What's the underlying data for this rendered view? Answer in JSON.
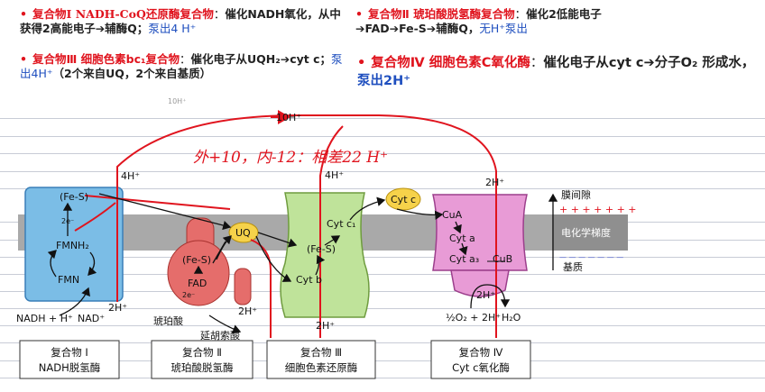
{
  "notes": [
    {
      "bullet": "•",
      "title": "复合物Ⅰ NADH-CoQ还原酶复合物",
      "colon": "：",
      "desc": "催化NADH氧化，从中获得2高能电子➔辅酶Q；",
      "pump": "泵出4 H⁺"
    },
    {
      "bullet": "•",
      "title": "复合物Ⅱ 琥珀酸脱氢酶复合物",
      "colon": "：",
      "desc": "催化2低能电子➔FAD➔Fe-S➔辅酶Q，",
      "pump": "无H⁺泵出"
    },
    {
      "bullet": "•",
      "title": "复合物Ⅲ 细胞色素bc₁复合物",
      "colon": "：",
      "desc": "催化电子从UQH₂➔cyt c；",
      "pump": "泵出4H⁺",
      "extra": "（2个来自UQ，2个来自基质）"
    },
    {
      "bullet": "•",
      "title": "复合物Ⅳ 细胞色素C氧化酶",
      "colon": "：",
      "desc": "催化电子从cyt c➔分子O₂ 形成水，",
      "pump": "泵出2H⁺"
    }
  ],
  "faint_text": "10H⁺",
  "handwritten": "外+10，内-12：相差22 H⁺",
  "diagram": {
    "top_h": "10H⁺",
    "c1_h": "4H⁺",
    "c3_h": "4H⁺",
    "c4_h": "2H⁺",
    "c1_in_h": "2H⁺",
    "c2_in_h": "2H⁺",
    "c3_in_h": "2H⁺",
    "c4_in_h": "2H⁺",
    "fes1": "(Fe-S)",
    "e1": "2e⁻",
    "fmnh2": "FMNH₂",
    "fmn": "FMN",
    "nadh": "NADH + H⁺",
    "nad": "NAD⁺",
    "fes2": "(Fe-S)",
    "fad": "FAD",
    "e2": "2e⁻",
    "succinate": "琥珀酸",
    "fumarate": "延胡索酸",
    "uq": "UQ",
    "cytc1": "Cyt c₁",
    "fes3": "(Fe-S)",
    "cytb": "Cyt b",
    "cytc": "Cyt c",
    "cua": "CuA",
    "cyta": "Cyt a",
    "cyta3": "Cyt a₃",
    "cub": "CuB",
    "o2": "½O₂ + 2H⁺",
    "h2o": "H₂O",
    "intermembrane": "膜间隙",
    "plus_marks": "+ + + + + + +",
    "gradient": "电化学梯度",
    "minus_marks": "— — — — — — —",
    "matrix": "基质",
    "box1_a": "复合物 Ⅰ",
    "box1_b": "NADH脱氢酶",
    "box2_a": "复合物 Ⅱ",
    "box2_b": "琥珀酸脱氢酶",
    "box3_a": "复合物 Ⅲ",
    "box3_b": "细胞色素还原酶",
    "box4_a": "复合物 Ⅳ",
    "box4_b": "Cyt c氧化酶"
  },
  "colors": {
    "red": "#e0141e",
    "blue": "#1f4fbf",
    "membrane": "#a9a9a9",
    "c1": "#7bbde6",
    "c2": "#e56d6b",
    "c3": "#bfe39a",
    "c4": "#e89bd6",
    "uq": "#f6d24a"
  }
}
